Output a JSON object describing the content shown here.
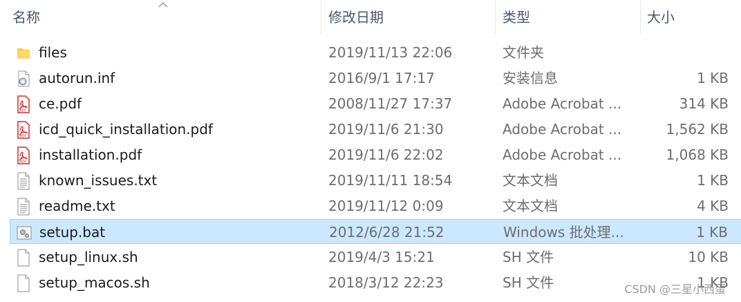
{
  "columns": {
    "name": "名称",
    "date": "修改日期",
    "type": "类型",
    "size": "大小"
  },
  "colors": {
    "selected_bg": "#cce8ff",
    "selected_border": "#99d1ff",
    "pdf_red": "#d32f2f",
    "folder_yellow": "#f8c64a"
  },
  "files": [
    {
      "name": "files",
      "date": "2019/11/13 22:06",
      "type": "文件夹",
      "size": "",
      "icon": "folder-icon"
    },
    {
      "name": "autorun.inf",
      "date": "2016/9/1 17:17",
      "type": "安装信息",
      "size": "1 KB",
      "icon": "setup-info-icon"
    },
    {
      "name": "ce.pdf",
      "date": "2008/11/27 17:37",
      "type": "Adobe Acrobat ...",
      "size": "314 KB",
      "icon": "pdf-icon"
    },
    {
      "name": "icd_quick_installation.pdf",
      "date": "2019/11/6 21:30",
      "type": "Adobe Acrobat ...",
      "size": "1,562 KB",
      "icon": "pdf-icon"
    },
    {
      "name": "installation.pdf",
      "date": "2019/11/6 22:02",
      "type": "Adobe Acrobat ...",
      "size": "1,068 KB",
      "icon": "pdf-icon"
    },
    {
      "name": "known_issues.txt",
      "date": "2019/11/11 18:54",
      "type": "文本文档",
      "size": "1 KB",
      "icon": "text-file-icon"
    },
    {
      "name": "readme.txt",
      "date": "2019/11/12 0:09",
      "type": "文本文档",
      "size": "4 KB",
      "icon": "text-file-icon"
    },
    {
      "name": "setup.bat",
      "date": "2012/6/28 21:52",
      "type": "Windows 批处理...",
      "size": "1 KB",
      "icon": "batch-file-icon",
      "selected": true
    },
    {
      "name": "setup_linux.sh",
      "date": "2019/4/3 15:21",
      "type": "SH 文件",
      "size": "10 KB",
      "icon": "blank-file-icon"
    },
    {
      "name": "setup_macos.sh",
      "date": "2018/3/12 22:23",
      "type": "SH 文件",
      "size": "1 KB",
      "icon": "blank-file-icon"
    }
  ],
  "watermark": "CSDN @三星小西蛋"
}
